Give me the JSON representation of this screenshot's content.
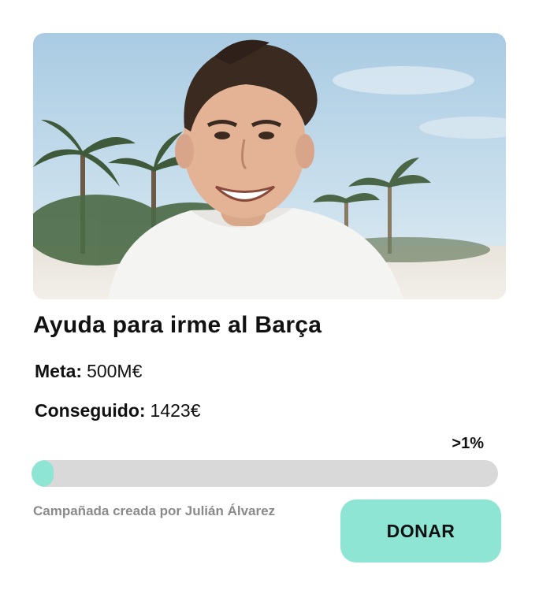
{
  "campaign": {
    "photo_description": "person-photo",
    "title": "Ayuda para irme al Barça",
    "goal_label": "Meta:",
    "goal_value": "500M€",
    "raised_label": "Conseguido:",
    "raised_value": "1423€",
    "percent_label": ">1%",
    "progress_fraction": 2.8e-06,
    "creator_text": "Campañada creada por Julián Álvarez",
    "donate_label": "DONAR"
  },
  "colors": {
    "accent": "#8ee5d3",
    "track": "#d9d9d9",
    "muted_text": "#8a8a8a",
    "text": "#111111"
  }
}
